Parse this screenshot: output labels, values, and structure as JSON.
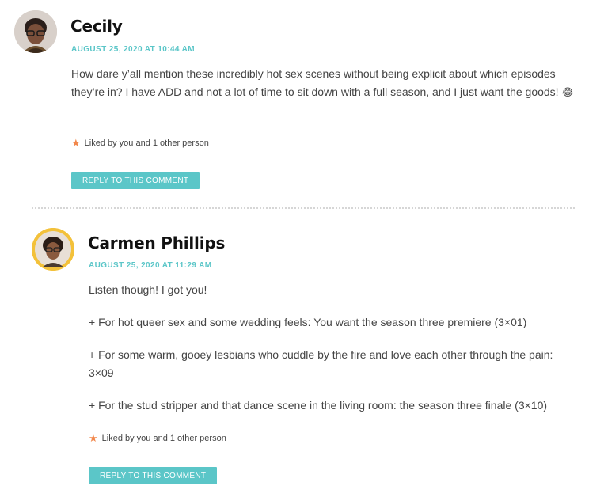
{
  "comments": [
    {
      "author": "Cecily",
      "date": "AUGUST 25, 2020 AT 10:44 AM",
      "paragraphs": [
        "How dare y’all mention these incredibly hot sex scenes without being explicit about which episodes they’re in? I have ADD and not a lot of time to sit down with a full season, and I just want the goods!"
      ],
      "emoji": "😂",
      "likes": "Liked by you and 1 other person",
      "reply_label": "REPLY TO THIS COMMENT"
    },
    {
      "author": "Carmen Phillips",
      "date": "AUGUST 25, 2020 AT 11:29 AM",
      "paragraphs": [
        "Listen though! I got you!",
        "+ For hot queer sex and some wedding feels: You want the season three premiere (3×01)",
        "+ For some warm, gooey lesbians who cuddle by the fire and love each other through the pain: 3×09",
        "+ For the stud stripper and that dance scene in the living room: the season three finale (3×10)"
      ],
      "likes": "Liked by you and 1 other person",
      "reply_label": "REPLY TO THIS COMMENT"
    }
  ],
  "icons": {
    "like": "star-icon"
  },
  "colors": {
    "accent": "#5bc6c8",
    "star": "#f2884c",
    "avatar_ring": "#f3c13a"
  }
}
